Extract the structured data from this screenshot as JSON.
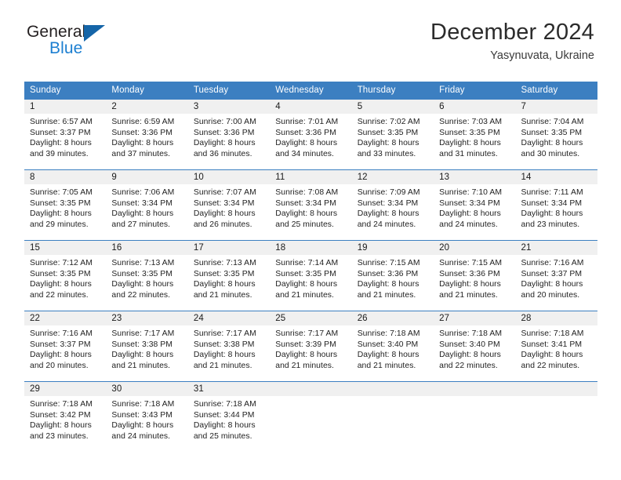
{
  "brand": {
    "name_part1": "General",
    "name_part2": "Blue",
    "flag_icon": "triangle-flag-icon"
  },
  "header": {
    "title": "December 2024",
    "location": "Yasynuvata, Ukraine"
  },
  "calendar": {
    "weekday_headers": [
      "Sunday",
      "Monday",
      "Tuesday",
      "Wednesday",
      "Thursday",
      "Friday",
      "Saturday"
    ],
    "colors": {
      "header_blue": "#3c7fc1",
      "daynum_band": "#f0f0f0",
      "brand_blue": "#1c7fd1",
      "flag_blue": "#1565a8",
      "text": "#1f1f1f"
    },
    "weeks": [
      [
        {
          "day": "1",
          "sunrise": "Sunrise: 6:57 AM",
          "sunset": "Sunset: 3:37 PM",
          "daylight_line1": "Daylight: 8 hours",
          "daylight_line2": "and 39 minutes."
        },
        {
          "day": "2",
          "sunrise": "Sunrise: 6:59 AM",
          "sunset": "Sunset: 3:36 PM",
          "daylight_line1": "Daylight: 8 hours",
          "daylight_line2": "and 37 minutes."
        },
        {
          "day": "3",
          "sunrise": "Sunrise: 7:00 AM",
          "sunset": "Sunset: 3:36 PM",
          "daylight_line1": "Daylight: 8 hours",
          "daylight_line2": "and 36 minutes."
        },
        {
          "day": "4",
          "sunrise": "Sunrise: 7:01 AM",
          "sunset": "Sunset: 3:36 PM",
          "daylight_line1": "Daylight: 8 hours",
          "daylight_line2": "and 34 minutes."
        },
        {
          "day": "5",
          "sunrise": "Sunrise: 7:02 AM",
          "sunset": "Sunset: 3:35 PM",
          "daylight_line1": "Daylight: 8 hours",
          "daylight_line2": "and 33 minutes."
        },
        {
          "day": "6",
          "sunrise": "Sunrise: 7:03 AM",
          "sunset": "Sunset: 3:35 PM",
          "daylight_line1": "Daylight: 8 hours",
          "daylight_line2": "and 31 minutes."
        },
        {
          "day": "7",
          "sunrise": "Sunrise: 7:04 AM",
          "sunset": "Sunset: 3:35 PM",
          "daylight_line1": "Daylight: 8 hours",
          "daylight_line2": "and 30 minutes."
        }
      ],
      [
        {
          "day": "8",
          "sunrise": "Sunrise: 7:05 AM",
          "sunset": "Sunset: 3:35 PM",
          "daylight_line1": "Daylight: 8 hours",
          "daylight_line2": "and 29 minutes."
        },
        {
          "day": "9",
          "sunrise": "Sunrise: 7:06 AM",
          "sunset": "Sunset: 3:34 PM",
          "daylight_line1": "Daylight: 8 hours",
          "daylight_line2": "and 27 minutes."
        },
        {
          "day": "10",
          "sunrise": "Sunrise: 7:07 AM",
          "sunset": "Sunset: 3:34 PM",
          "daylight_line1": "Daylight: 8 hours",
          "daylight_line2": "and 26 minutes."
        },
        {
          "day": "11",
          "sunrise": "Sunrise: 7:08 AM",
          "sunset": "Sunset: 3:34 PM",
          "daylight_line1": "Daylight: 8 hours",
          "daylight_line2": "and 25 minutes."
        },
        {
          "day": "12",
          "sunrise": "Sunrise: 7:09 AM",
          "sunset": "Sunset: 3:34 PM",
          "daylight_line1": "Daylight: 8 hours",
          "daylight_line2": "and 24 minutes."
        },
        {
          "day": "13",
          "sunrise": "Sunrise: 7:10 AM",
          "sunset": "Sunset: 3:34 PM",
          "daylight_line1": "Daylight: 8 hours",
          "daylight_line2": "and 24 minutes."
        },
        {
          "day": "14",
          "sunrise": "Sunrise: 7:11 AM",
          "sunset": "Sunset: 3:34 PM",
          "daylight_line1": "Daylight: 8 hours",
          "daylight_line2": "and 23 minutes."
        }
      ],
      [
        {
          "day": "15",
          "sunrise": "Sunrise: 7:12 AM",
          "sunset": "Sunset: 3:35 PM",
          "daylight_line1": "Daylight: 8 hours",
          "daylight_line2": "and 22 minutes."
        },
        {
          "day": "16",
          "sunrise": "Sunrise: 7:13 AM",
          "sunset": "Sunset: 3:35 PM",
          "daylight_line1": "Daylight: 8 hours",
          "daylight_line2": "and 22 minutes."
        },
        {
          "day": "17",
          "sunrise": "Sunrise: 7:13 AM",
          "sunset": "Sunset: 3:35 PM",
          "daylight_line1": "Daylight: 8 hours",
          "daylight_line2": "and 21 minutes."
        },
        {
          "day": "18",
          "sunrise": "Sunrise: 7:14 AM",
          "sunset": "Sunset: 3:35 PM",
          "daylight_line1": "Daylight: 8 hours",
          "daylight_line2": "and 21 minutes."
        },
        {
          "day": "19",
          "sunrise": "Sunrise: 7:15 AM",
          "sunset": "Sunset: 3:36 PM",
          "daylight_line1": "Daylight: 8 hours",
          "daylight_line2": "and 21 minutes."
        },
        {
          "day": "20",
          "sunrise": "Sunrise: 7:15 AM",
          "sunset": "Sunset: 3:36 PM",
          "daylight_line1": "Daylight: 8 hours",
          "daylight_line2": "and 21 minutes."
        },
        {
          "day": "21",
          "sunrise": "Sunrise: 7:16 AM",
          "sunset": "Sunset: 3:37 PM",
          "daylight_line1": "Daylight: 8 hours",
          "daylight_line2": "and 20 minutes."
        }
      ],
      [
        {
          "day": "22",
          "sunrise": "Sunrise: 7:16 AM",
          "sunset": "Sunset: 3:37 PM",
          "daylight_line1": "Daylight: 8 hours",
          "daylight_line2": "and 20 minutes."
        },
        {
          "day": "23",
          "sunrise": "Sunrise: 7:17 AM",
          "sunset": "Sunset: 3:38 PM",
          "daylight_line1": "Daylight: 8 hours",
          "daylight_line2": "and 21 minutes."
        },
        {
          "day": "24",
          "sunrise": "Sunrise: 7:17 AM",
          "sunset": "Sunset: 3:38 PM",
          "daylight_line1": "Daylight: 8 hours",
          "daylight_line2": "and 21 minutes."
        },
        {
          "day": "25",
          "sunrise": "Sunrise: 7:17 AM",
          "sunset": "Sunset: 3:39 PM",
          "daylight_line1": "Daylight: 8 hours",
          "daylight_line2": "and 21 minutes."
        },
        {
          "day": "26",
          "sunrise": "Sunrise: 7:18 AM",
          "sunset": "Sunset: 3:40 PM",
          "daylight_line1": "Daylight: 8 hours",
          "daylight_line2": "and 21 minutes."
        },
        {
          "day": "27",
          "sunrise": "Sunrise: 7:18 AM",
          "sunset": "Sunset: 3:40 PM",
          "daylight_line1": "Daylight: 8 hours",
          "daylight_line2": "and 22 minutes."
        },
        {
          "day": "28",
          "sunrise": "Sunrise: 7:18 AM",
          "sunset": "Sunset: 3:41 PM",
          "daylight_line1": "Daylight: 8 hours",
          "daylight_line2": "and 22 minutes."
        }
      ],
      [
        {
          "day": "29",
          "sunrise": "Sunrise: 7:18 AM",
          "sunset": "Sunset: 3:42 PM",
          "daylight_line1": "Daylight: 8 hours",
          "daylight_line2": "and 23 minutes."
        },
        {
          "day": "30",
          "sunrise": "Sunrise: 7:18 AM",
          "sunset": "Sunset: 3:43 PM",
          "daylight_line1": "Daylight: 8 hours",
          "daylight_line2": "and 24 minutes."
        },
        {
          "day": "31",
          "sunrise": "Sunrise: 7:18 AM",
          "sunset": "Sunset: 3:44 PM",
          "daylight_line1": "Daylight: 8 hours",
          "daylight_line2": "and 25 minutes."
        },
        {
          "day": "",
          "sunrise": "",
          "sunset": "",
          "daylight_line1": "",
          "daylight_line2": ""
        },
        {
          "day": "",
          "sunrise": "",
          "sunset": "",
          "daylight_line1": "",
          "daylight_line2": ""
        },
        {
          "day": "",
          "sunrise": "",
          "sunset": "",
          "daylight_line1": "",
          "daylight_line2": ""
        },
        {
          "day": "",
          "sunrise": "",
          "sunset": "",
          "daylight_line1": "",
          "daylight_line2": ""
        }
      ]
    ]
  }
}
